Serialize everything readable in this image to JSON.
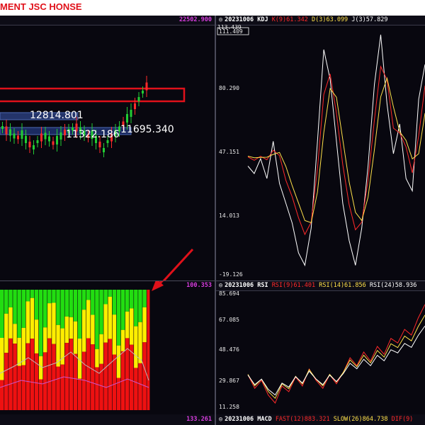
{
  "app": {
    "title": "MENT JSC  HONSE"
  },
  "price_panel": {
    "top_value": "22502.900",
    "labels": [
      "12814.801",
      "11322.186",
      "11695.340"
    ]
  },
  "kdj_panel": {
    "date": "20231006",
    "name": "KDJ",
    "k_label": "K(9)61.342",
    "d_label": "D(3)63.099",
    "j_label": "J(3)57.829",
    "axis": [
      "113.439",
      "111.409",
      "80.290",
      "47.151",
      "14.013",
      "-19.126"
    ]
  },
  "volume_panel": {
    "top_value": "100.353"
  },
  "rsi_panel": {
    "date": "20231006",
    "name": "RSI",
    "rsi9": "RSI(9)61.401",
    "rsi14": "RSI(14)61.856",
    "rsi24": "RSI(24)58.936",
    "axis": [
      "85.694",
      "67.085",
      "48.476",
      "29.867",
      "11.258"
    ]
  },
  "bottom_left": {
    "top_value": "133.261"
  },
  "macd_panel": {
    "date": "20231006",
    "name": "MACD",
    "fast": "FAST(12)883.321",
    "slow": "SLOW(26)864.738",
    "dif": "DIF(9)"
  },
  "colors": {
    "background": "#08070f",
    "k_line": "#ff2a2a",
    "d_line": "#ffe14a",
    "j_line": "#ffffff",
    "candle_up": "#22cc33",
    "candle_down": "#ff2a2a",
    "highlight_box": "#e0111a",
    "arrow": "#e0111a",
    "bar_green": "#22dd11",
    "bar_yellow": "#ffee00",
    "bar_red": "#ee1111"
  }
}
